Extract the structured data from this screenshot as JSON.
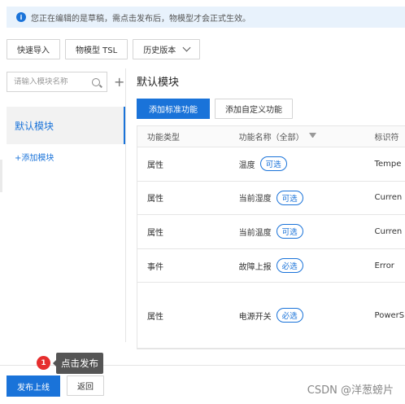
{
  "notice": {
    "icon": "info-icon",
    "text": "您正在编辑的是草稿，需点击发布后，物模型才会正式生效。"
  },
  "toolbar": {
    "quick_import": "快速导入",
    "tsl": "物模型 TSL",
    "history": "历史版本"
  },
  "sidebar": {
    "search_placeholder": "请输入模块名称",
    "modules": [
      {
        "label": "默认模块"
      }
    ],
    "add_module": "+添加模块"
  },
  "main": {
    "title": "默认模块",
    "add_standard": "添加标准功能",
    "add_custom": "添加自定义功能",
    "columns": {
      "type": "功能类型",
      "name": "功能名称（全部）",
      "id": "标识符"
    },
    "rows": [
      {
        "type": "属性",
        "name": "温度",
        "tag": "可选",
        "id": "Tempe"
      },
      {
        "type": "属性",
        "name": "当前湿度",
        "tag": "可选",
        "id": "Curren"
      },
      {
        "type": "属性",
        "name": "当前温度",
        "tag": "可选",
        "id": "Curren"
      },
      {
        "type": "事件",
        "name": "故障上报",
        "tag": "必选",
        "id": "Error"
      },
      {
        "type": "属性",
        "name": "电源开关",
        "tag": "必选",
        "id": "PowerS"
      }
    ]
  },
  "footer": {
    "publish": "发布上线",
    "back": "返回"
  },
  "tip": {
    "badge": "1",
    "text": "点击发布"
  },
  "watermark": "CSDN @洋葱螃片",
  "colors": {
    "primary": "#1a73d9",
    "badge": "#e62e2e",
    "tooltip": "#555555"
  }
}
